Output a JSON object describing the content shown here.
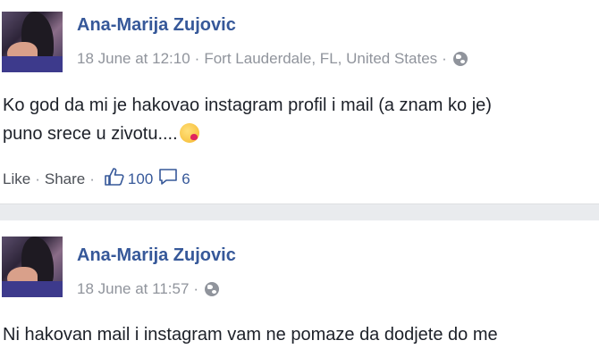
{
  "posts": [
    {
      "author": "Ana-Marija Zujovic",
      "date": "18 June at 12:10",
      "location": "Fort Lauderdale, FL, United States",
      "text_line1": "Ko god da mi je hakovao instagram profil i mail (a znam ko je)",
      "text_line2": "puno srece u zivotu....",
      "emoji": "kiss-emoji",
      "like_label": "Like",
      "share_label": "Share",
      "likes": "100",
      "comments": "6"
    },
    {
      "author": "Ana-Marija Zujovic",
      "date": "18 June at 11:57",
      "text_line1": "Ni hakovan mail i instagram vam ne pomaze da dodjete do me"
    }
  ],
  "icons": {
    "privacy": "globe-icon",
    "like": "thumbs-up-icon",
    "comment": "comment-icon"
  },
  "colors": {
    "name_blue": "#365899",
    "meta_gray": "#90949c",
    "text": "#1d2129",
    "separator": "#e9ebee"
  }
}
